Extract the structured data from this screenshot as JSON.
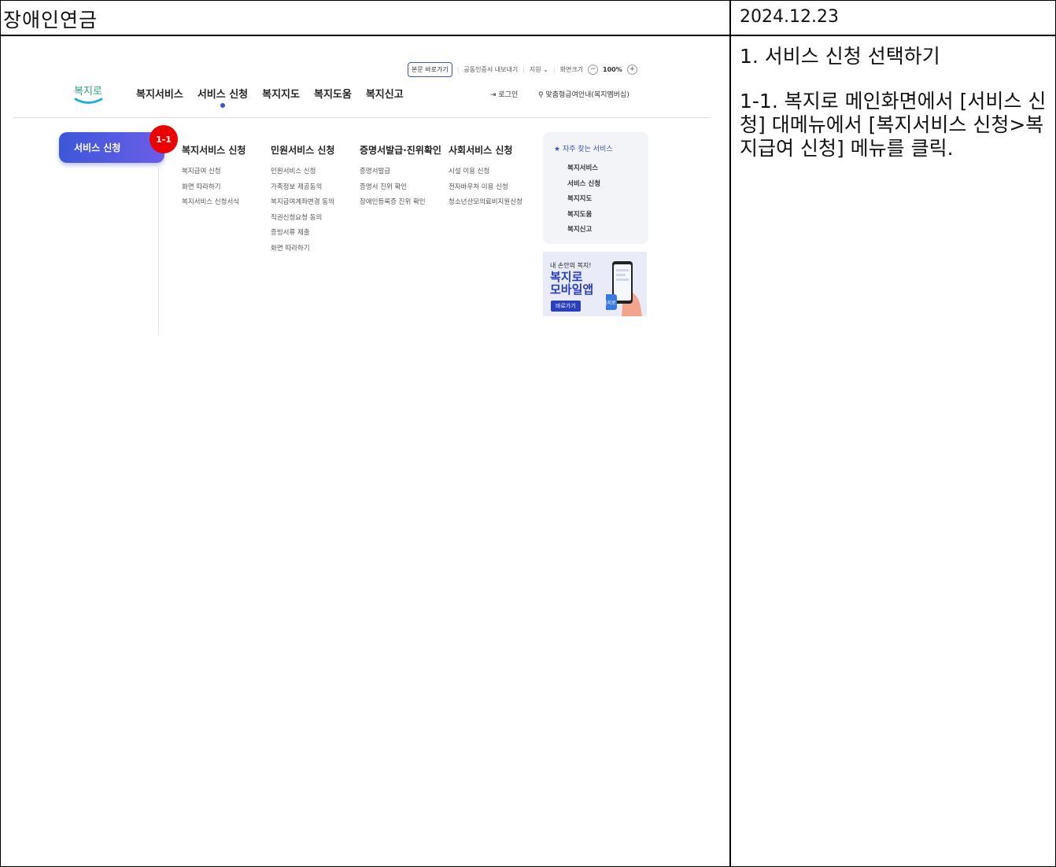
{
  "document": {
    "title": "장애인연금",
    "date": "2024.12.23",
    "step_title": "1. 서비스 신청 선택하기",
    "step_desc": "1-1. 복지로 메인화면에서 [서비스 신청] 대메뉴에서 [복지서비스 신청>복지급여 신청] 메뉴를 클릭."
  },
  "site": {
    "logo_text": "복지로",
    "util_bar": {
      "skip_link": "본문 바로가기",
      "cert_export": "공동인증서 내보내기",
      "support": "지원 ⌄",
      "screen_size": "화면크기",
      "zoom_minus": "−",
      "zoom_value": "100%",
      "zoom_plus": "+"
    },
    "gnb": [
      "복지서비스",
      "서비스 신청",
      "복지지도",
      "복지도움",
      "복지신고"
    ],
    "login": "⇥ 로그인",
    "member_info": "맞춤형급여안내(복지멤버십)",
    "side_menu": "서비스 신청",
    "annotation_badge": "1-1",
    "columns": [
      {
        "title": "복지서비스 신청",
        "items": [
          "복지급여 신청",
          "화면 따라하기",
          "복지서비스 신청서식"
        ]
      },
      {
        "title": "민원서비스 신청",
        "items": [
          "민원서비스 신청",
          "가족정보 제공동의",
          "복지급여계좌변경 동의",
          "직권신청요청 동의",
          "증빙서류 제출",
          "화면 따라하기"
        ]
      },
      {
        "title": "증명서발급·진위확인",
        "items": [
          "증명서발급",
          "증명서 진위 확인",
          "장애인등록증 진위 확인"
        ]
      },
      {
        "title": "사회서비스 신청",
        "items": [
          "시설 이용 신청",
          "전자바우처 이용 신청",
          "청소년산모의료비지원신청"
        ]
      }
    ],
    "favorites": {
      "title": "자주 찾는 서비스",
      "items": [
        "복지서비스",
        "서비스 신청",
        "복지지도",
        "복지도움",
        "복지신고"
      ]
    },
    "promo": {
      "small": "내 손안의 복지!",
      "line1": "복지로",
      "line2": "모바일앱",
      "button": "바로가기",
      "phone_logo": "복지로"
    },
    "colors": {
      "accent": "#3b56c4",
      "badge": "#e00000",
      "promo_blue": "#2a3fbd"
    }
  }
}
